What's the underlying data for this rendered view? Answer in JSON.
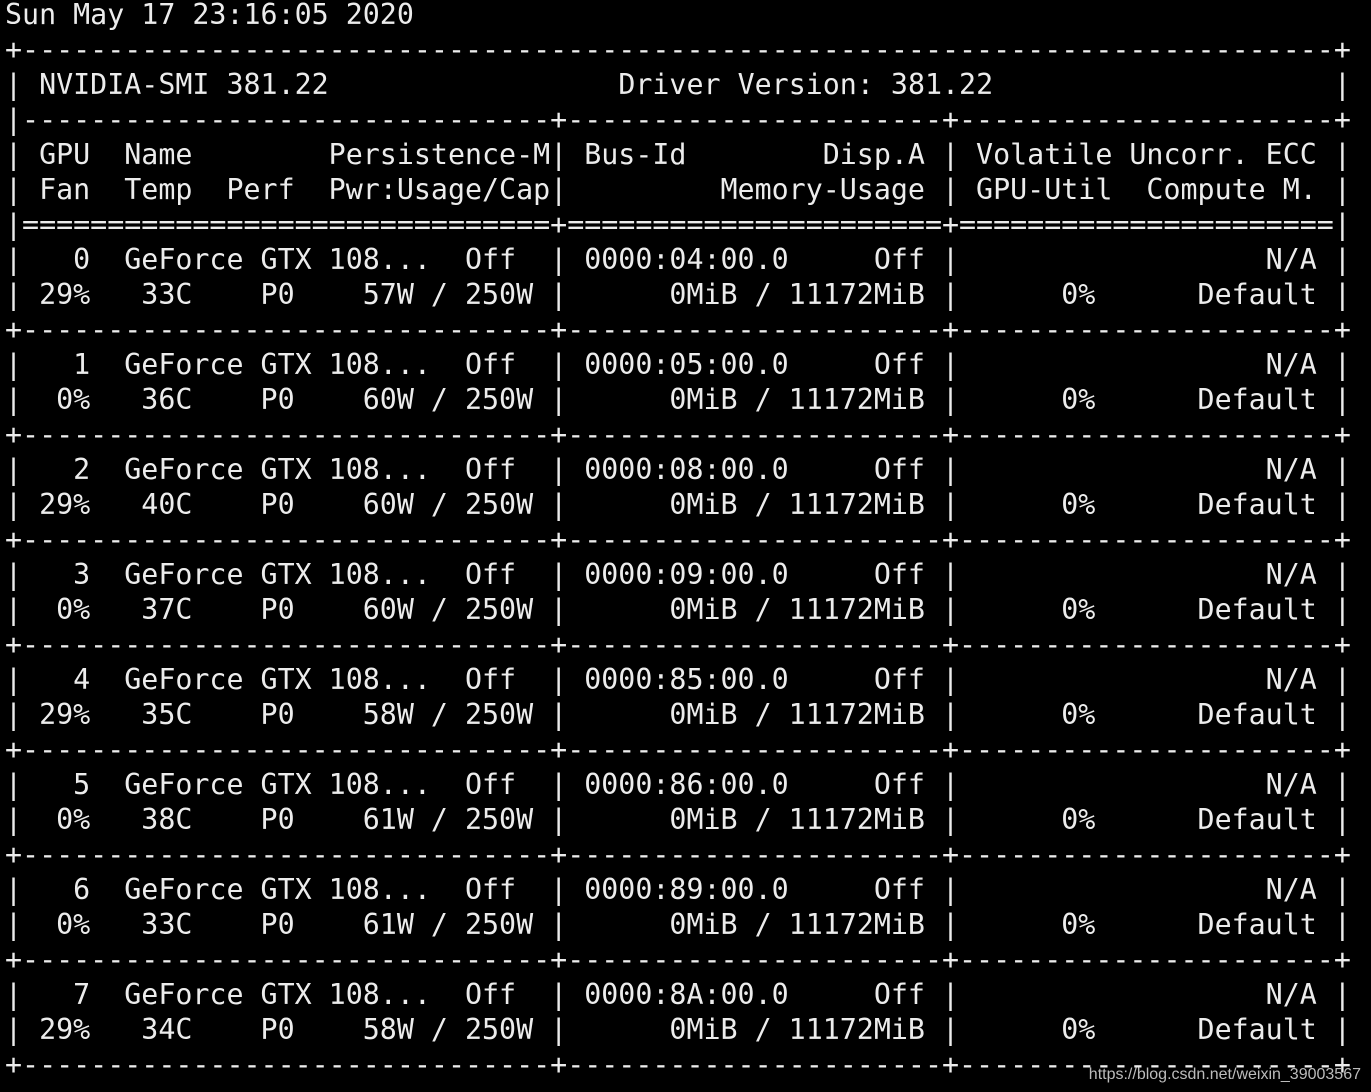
{
  "terminal": {
    "timestamp": "Sun May 17 23:16:05 2020",
    "header": {
      "tool": "NVIDIA-SMI 381.22",
      "driver": "Driver Version: 381.22"
    },
    "column_headers": [
      "| GPU  Name        Persistence-M| Bus-Id        Disp.A | Volatile Uncorr. ECC |",
      "| Fan  Temp  Perf  Pwr:Usage/Cap|         Memory-Usage | GPU-Util  Compute M. |"
    ],
    "gpus": [
      {
        "line1": "|   0  GeForce GTX 108...  Off  | 0000:04:00.0     Off |                  N/A |",
        "line2": "| 29%   33C    P0    57W / 250W |      0MiB / 11172MiB |      0%      Default |"
      },
      {
        "line1": "|   1  GeForce GTX 108...  Off  | 0000:05:00.0     Off |                  N/A |",
        "line2": "|  0%   36C    P0    60W / 250W |      0MiB / 11172MiB |      0%      Default |"
      },
      {
        "line1": "|   2  GeForce GTX 108...  Off  | 0000:08:00.0     Off |                  N/A |",
        "line2": "| 29%   40C    P0    60W / 250W |      0MiB / 11172MiB |      0%      Default |"
      },
      {
        "line1": "|   3  GeForce GTX 108...  Off  | 0000:09:00.0     Off |                  N/A |",
        "line2": "|  0%   37C    P0    60W / 250W |      0MiB / 11172MiB |      0%      Default |"
      },
      {
        "line1": "|   4  GeForce GTX 108...  Off  | 0000:85:00.0     Off |                  N/A |",
        "line2": "| 29%   35C    P0    58W / 250W |      0MiB / 11172MiB |      0%      Default |"
      },
      {
        "line1": "|   5  GeForce GTX 108...  Off  | 0000:86:00.0     Off |                  N/A |",
        "line2": "|  0%   38C    P0    61W / 250W |      0MiB / 11172MiB |      0%      Default |"
      },
      {
        "line1": "|   6  GeForce GTX 108...  Off  | 0000:89:00.0     Off |                  N/A |",
        "line2": "|  0%   33C    P0    61W / 250W |      0MiB / 11172MiB |      0%      Default |"
      },
      {
        "line1": "|   7  GeForce GTX 108...  Off  | 0000:8A:00.0     Off |                  N/A |",
        "line2": "| 29%   34C    P0    58W / 250W |      0MiB / 11172MiB |      0%      Default |"
      }
    ]
  },
  "watermark": "https://blog.csdn.net/weixin_39003567",
  "colors": {
    "background": "#000000",
    "foreground": "#ececec"
  }
}
